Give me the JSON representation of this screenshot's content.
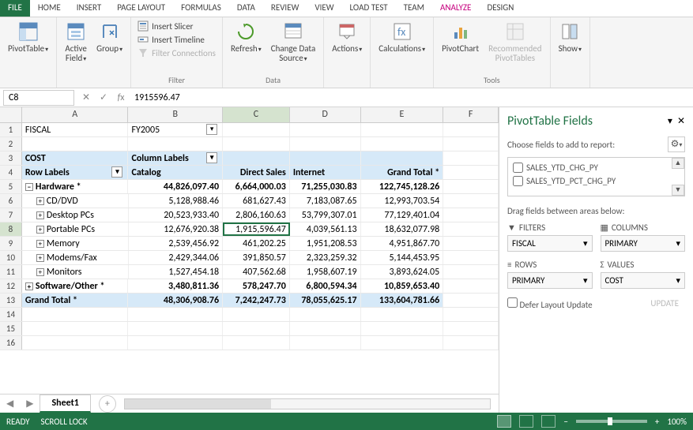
{
  "menu": {
    "file": "FILE",
    "tabs": [
      "HOME",
      "INSERT",
      "PAGE LAYOUT",
      "FORMULAS",
      "DATA",
      "REVIEW",
      "VIEW",
      "LOAD TEST",
      "TEAM",
      "ANALYZE",
      "DESIGN"
    ],
    "active_index": 9
  },
  "ribbon": {
    "pivottable": "PivotTable",
    "active_field": "Active\nField",
    "group": "Group",
    "slicer": "Insert Slicer",
    "timeline": "Insert Timeline",
    "filter_conn": "Filter Connections",
    "filter_label": "Filter",
    "refresh": "Refresh",
    "change_src": "Change Data\nSource",
    "data_label": "Data",
    "actions": "Actions",
    "calc": "Calculations",
    "pivotchart": "PivotChart",
    "rec": "Recommended\nPivotTables",
    "tools_label": "Tools",
    "show": "Show"
  },
  "formula": {
    "name_box": "C8",
    "value": "1915596.47"
  },
  "grid": {
    "cols": [
      "A",
      "B",
      "C",
      "D",
      "E",
      "F"
    ],
    "selected_col": "C",
    "selected_row": 8,
    "r1": {
      "a": "FISCAL",
      "b": "FY2005"
    },
    "r3": {
      "a": "COST",
      "b": "Column Labels"
    },
    "r4": {
      "a": "Row Labels",
      "b": "Catalog",
      "c": "Direct Sales",
      "d": "Internet",
      "e": "Grand Total *"
    },
    "r5": {
      "a": "Hardware *",
      "b": "44,826,097.40",
      "c": "6,664,000.03",
      "d": "71,255,030.83",
      "e": "122,745,128.26"
    },
    "r6": {
      "a": "CD/DVD",
      "b": "5,128,988.46",
      "c": "681,627.43",
      "d": "7,183,087.65",
      "e": "12,993,703.54"
    },
    "r7": {
      "a": "Desktop PCs",
      "b": "20,523,933.40",
      "c": "2,806,160.63",
      "d": "53,799,307.01",
      "e": "77,129,401.04"
    },
    "r8": {
      "a": "Portable PCs",
      "b": "12,676,920.38",
      "c": "1,915,596.47",
      "d": "4,039,561.13",
      "e": "18,632,077.98"
    },
    "r9": {
      "a": "Memory",
      "b": "2,539,456.92",
      "c": "461,202.25",
      "d": "1,951,208.53",
      "e": "4,951,867.70"
    },
    "r10": {
      "a": "Modems/Fax",
      "b": "2,429,344.06",
      "c": "391,850.57",
      "d": "2,323,259.32",
      "e": "5,144,453.95"
    },
    "r11": {
      "a": "Monitors",
      "b": "1,527,454.18",
      "c": "407,562.68",
      "d": "1,958,607.19",
      "e": "3,893,624.05"
    },
    "r12": {
      "a": "Software/Other *",
      "b": "3,480,811.36",
      "c": "578,247.70",
      "d": "6,800,594.34",
      "e": "10,859,653.40"
    },
    "r13": {
      "a": "Grand Total *",
      "b": "48,306,908.76",
      "c": "7,242,247.73",
      "d": "78,055,625.17",
      "e": "133,604,781.66"
    }
  },
  "panel": {
    "title": "PivotTable Fields",
    "choose": "Choose fields to add to report:",
    "fields": [
      "SALES_YTD_CHG_PY",
      "SALES_YTD_PCT_CHG_PY"
    ],
    "drag": "Drag fields between areas below:",
    "filters_label": "FILTERS",
    "columns_label": "COLUMNS",
    "rows_label": "ROWS",
    "values_label": "VALUES",
    "filters_val": "FISCAL",
    "columns_val": "PRIMARY",
    "rows_val": "PRIMARY",
    "values_val": "COST",
    "defer": "Defer Layout Update",
    "update": "UPDATE"
  },
  "sheets": {
    "active": "Sheet1"
  },
  "status": {
    "ready": "READY",
    "scroll": "SCROLL LOCK",
    "zoom": "100%"
  }
}
